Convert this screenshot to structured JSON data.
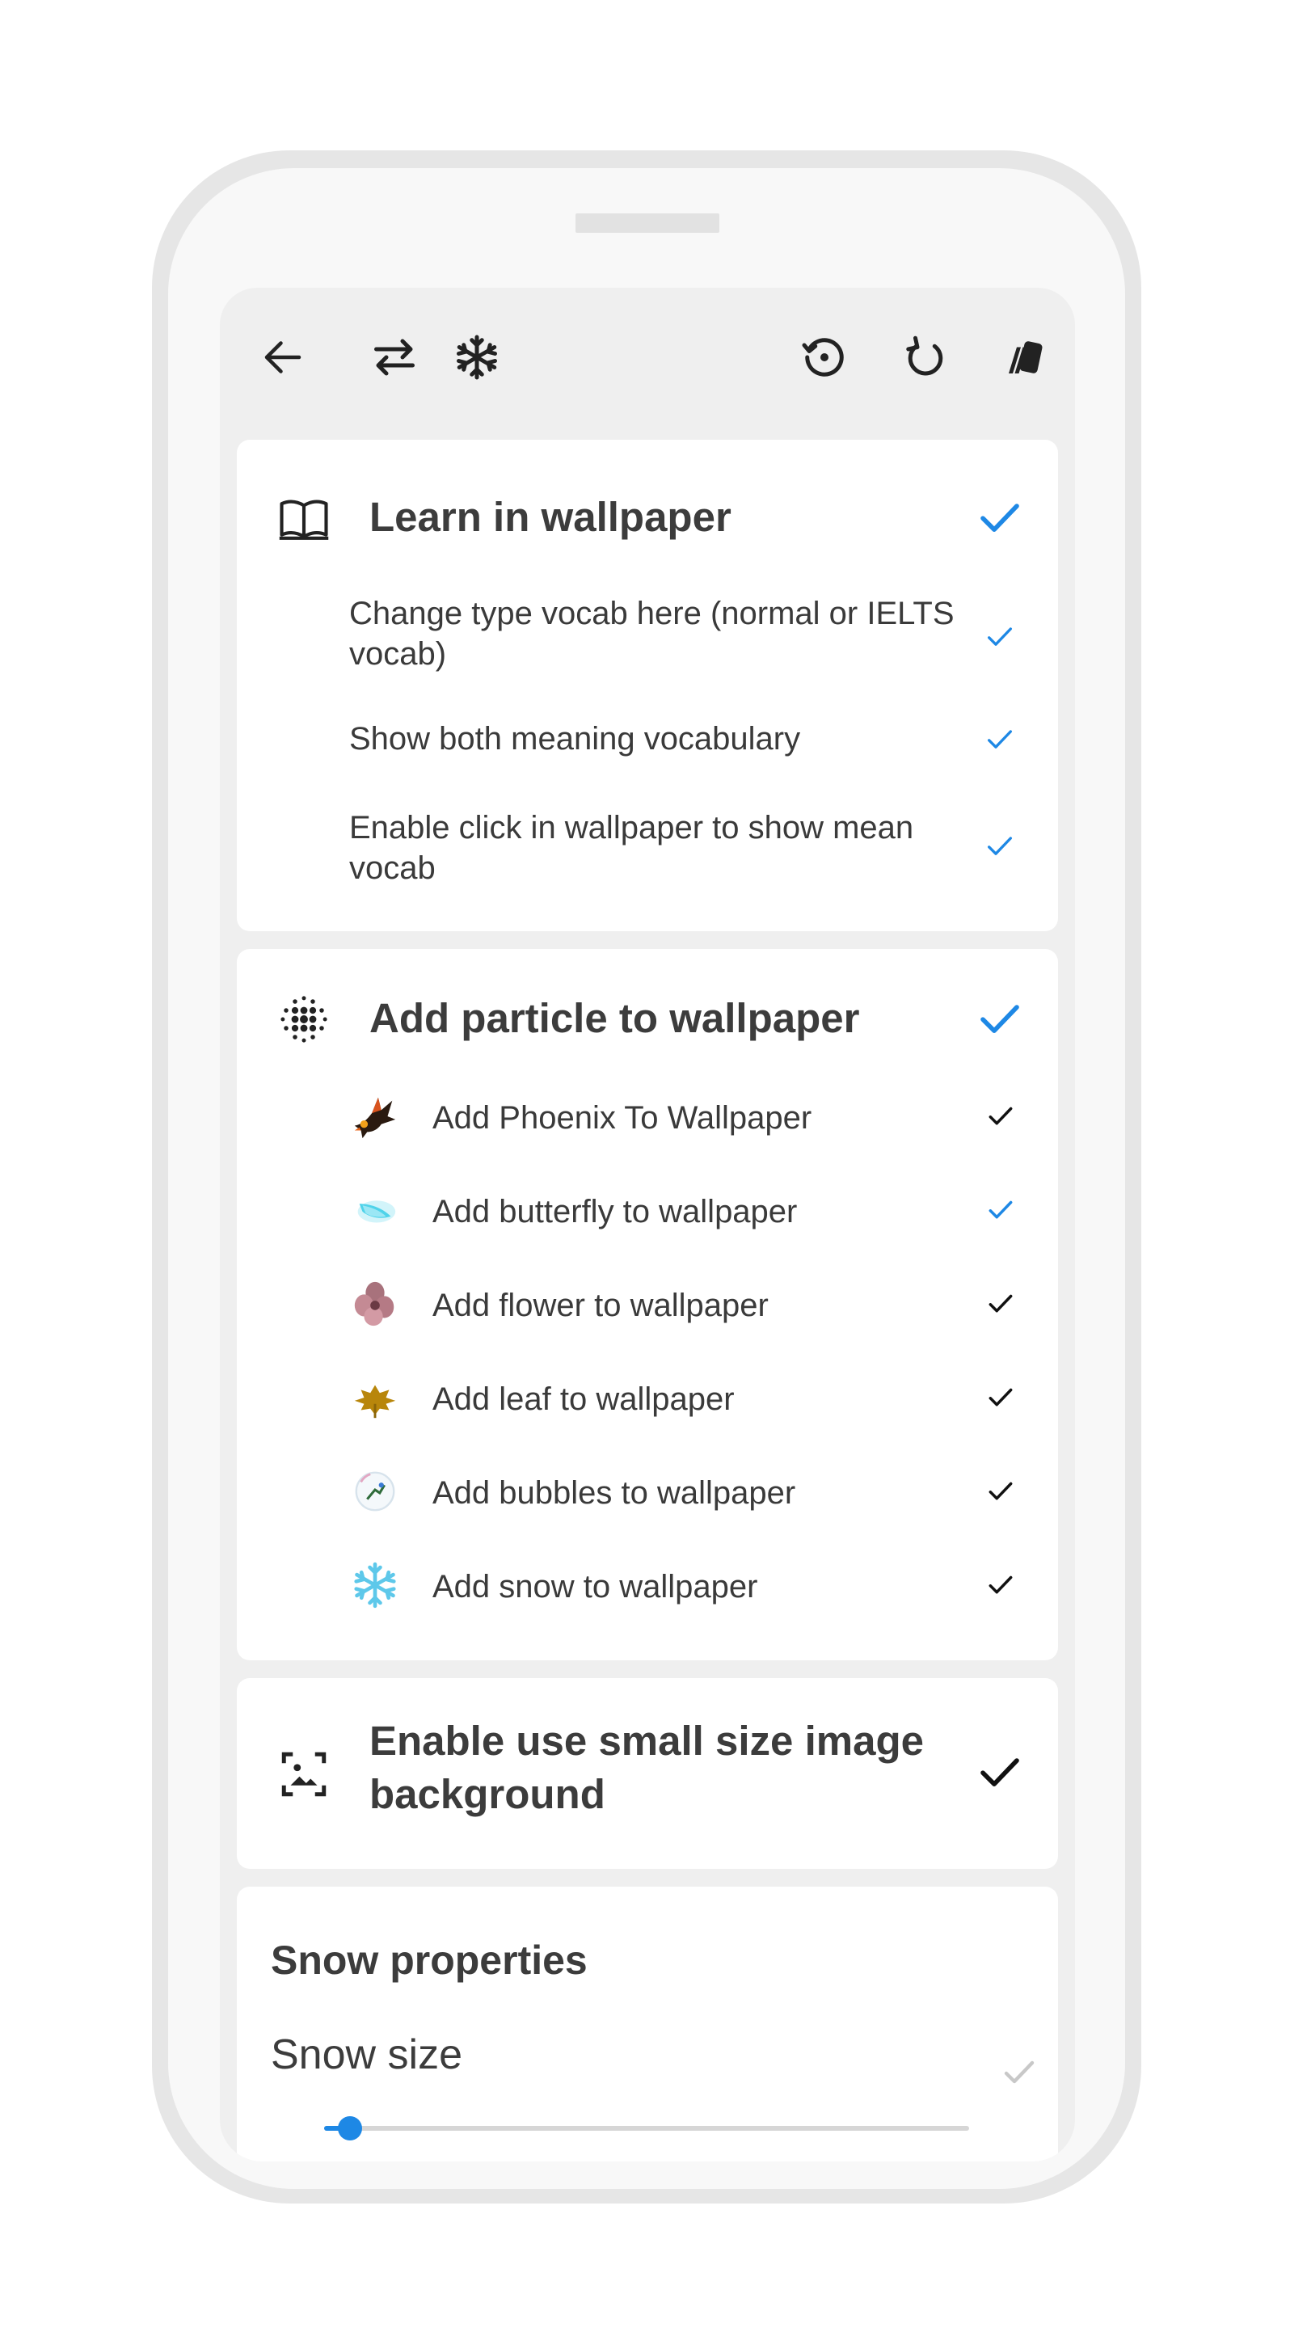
{
  "toolbar": {
    "icons": [
      "back-arrow-icon",
      "swap-icon",
      "snowflake-icon",
      "restore-icon",
      "refresh-icon",
      "cards-icon"
    ]
  },
  "learn_section": {
    "title": "Learn in wallpaper",
    "checked": true,
    "items": [
      {
        "label": "Change type vocab here (normal or IELTS vocab)",
        "checked": true,
        "check_color": "#1e88e5"
      },
      {
        "label": "Show both meaning vocabulary",
        "checked": true,
        "check_color": "#1e88e5"
      },
      {
        "label": "Enable click in wallpaper to show mean vocab",
        "checked": true,
        "check_color": "#1e88e5"
      }
    ]
  },
  "particle_section": {
    "title": "Add particle to wallpaper",
    "checked": true,
    "items": [
      {
        "label": "Add Phoenix To Wallpaper",
        "icon": "phoenix-icon",
        "checked": true,
        "check_color": "#111111"
      },
      {
        "label": "Add butterfly to wallpaper",
        "icon": "butterfly-icon",
        "checked": true,
        "check_color": "#1e88e5"
      },
      {
        "label": "Add flower to wallpaper",
        "icon": "flower-icon",
        "checked": true,
        "check_color": "#111111"
      },
      {
        "label": "Add leaf to wallpaper",
        "icon": "leaf-icon",
        "checked": true,
        "check_color": "#111111"
      },
      {
        "label": "Add bubbles to wallpaper",
        "icon": "bubble-icon",
        "checked": true,
        "check_color": "#111111"
      },
      {
        "label": "Add snow to wallpaper",
        "icon": "snow-icon",
        "checked": true,
        "check_color": "#111111"
      }
    ]
  },
  "small_image_section": {
    "title_line1": "Enable use small size image",
    "title_line2": "background",
    "checked": true
  },
  "snow_properties": {
    "title": "Snow properties",
    "size_label": "Snow size",
    "size_value_fraction": 0.04
  },
  "colors": {
    "accent": "#1e88e5",
    "check_dark": "#111111",
    "screen_bg": "#efefef",
    "card_bg": "#ffffff"
  }
}
